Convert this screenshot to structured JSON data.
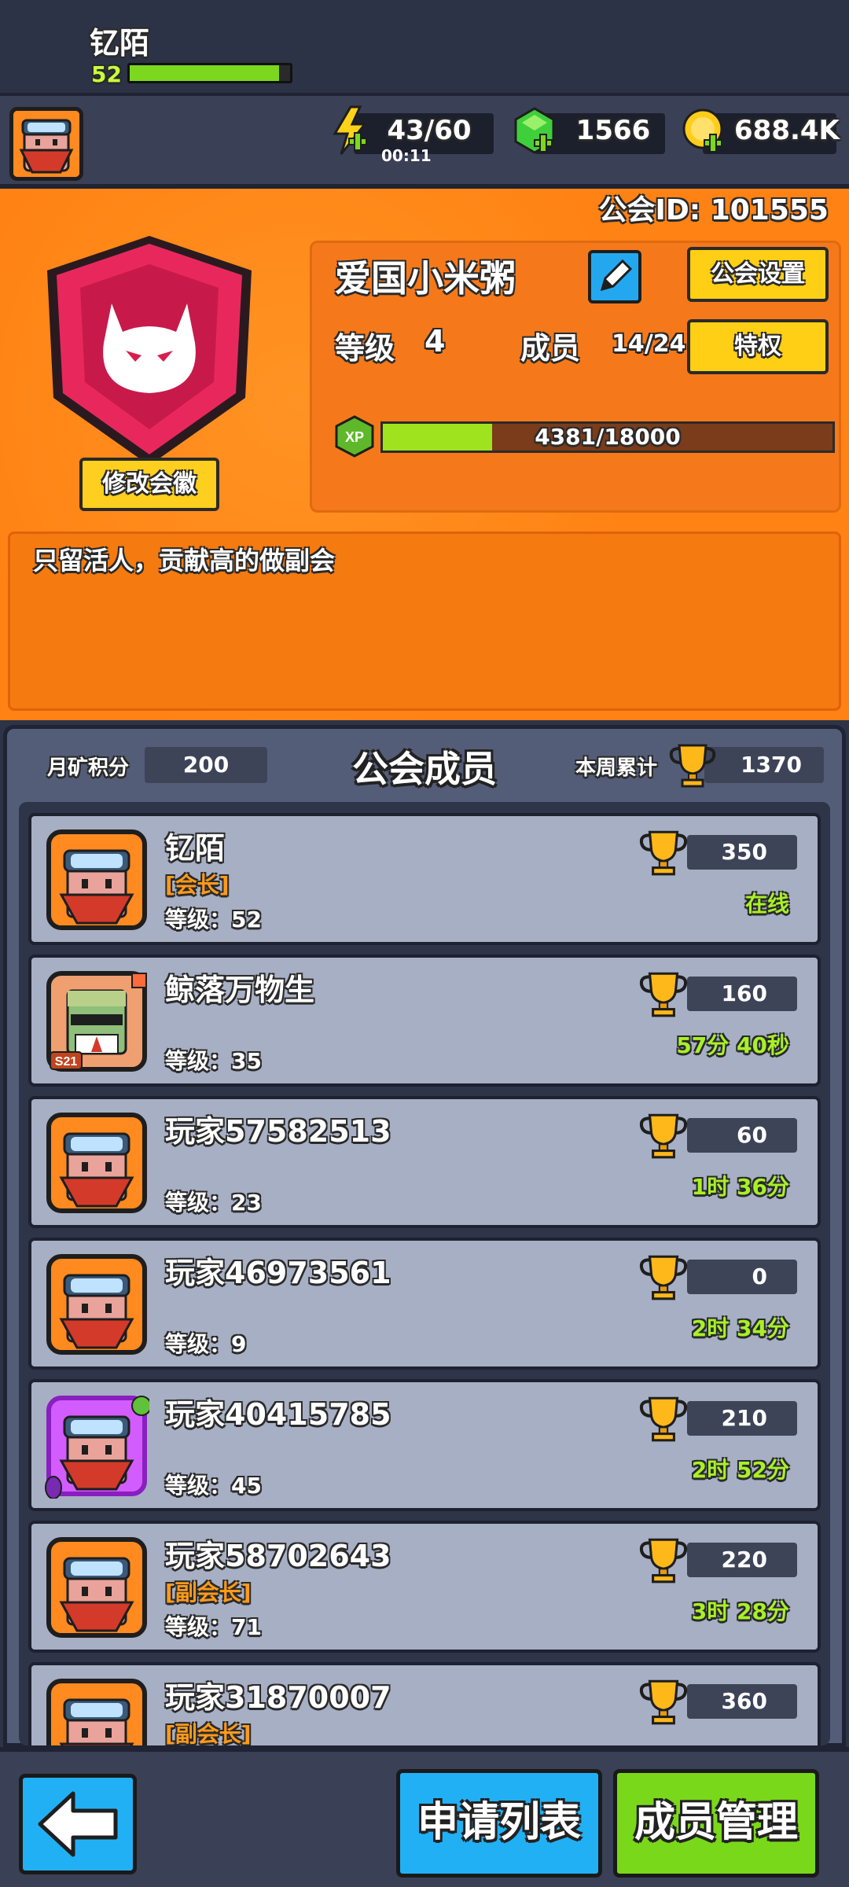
{
  "player": {
    "name": "钇陌",
    "level": "52",
    "xp_fraction": 0.93
  },
  "resources": {
    "energy": "43/60",
    "energy_timer": "00:11",
    "gems": "1566",
    "coins": "688.4K"
  },
  "guild": {
    "id_label": "公会ID: 101555",
    "name": "爱国小米粥",
    "change_badge": "修改会徽",
    "settings_button": "公会设置",
    "perks_button": "特权",
    "level_label": "等级",
    "level_value": "4",
    "members_label": "成员",
    "members_value": "14/24",
    "xp_text": "4381/18000",
    "xp_fraction": 0.243,
    "xp_icon_label": "XP",
    "notice": "只留活人，贡献高的做副会"
  },
  "members_panel": {
    "month_label": "月矿积分",
    "month_value": "200",
    "title": "公会成员",
    "week_label": "本周累计",
    "week_value": "1370"
  },
  "members": [
    {
      "name": "钇陌",
      "role": "[会长]",
      "level": "等级：52",
      "trophies": "350",
      "status": "在线",
      "avatar": "orange"
    },
    {
      "name": "鲸落万物生",
      "role": "",
      "level": "等级：35",
      "trophies": "160",
      "status": "57分 40秒",
      "avatar": "zombie",
      "badge": "S21"
    },
    {
      "name": "玩家57582513",
      "role": "",
      "level": "等级：23",
      "trophies": "60",
      "status": "1时 36分",
      "avatar": "orange"
    },
    {
      "name": "玩家46973561",
      "role": "",
      "level": "等级：9",
      "trophies": "0",
      "status": "2时 34分",
      "avatar": "orange"
    },
    {
      "name": "玩家40415785",
      "role": "",
      "level": "等级：45",
      "trophies": "210",
      "status": "2时 52分",
      "avatar": "purple"
    },
    {
      "name": "玩家58702643",
      "role": "[副会长]",
      "level": "等级：71",
      "trophies": "220",
      "status": "3时 28分",
      "avatar": "orange"
    },
    {
      "name": "玩家31870007",
      "role": "[副会长]",
      "level": "",
      "trophies": "360",
      "status": "",
      "avatar": "orange"
    }
  ],
  "bottom": {
    "apply_list": "申请列表",
    "member_manage": "成员管理"
  },
  "colors": {
    "orange_panel": "#ff8214",
    "member_card": "#a7afc4",
    "status_green": "#a8f028",
    "button_yellow": "#ffcf16",
    "button_blue": "#22b0f5",
    "button_green": "#7ad81a"
  }
}
